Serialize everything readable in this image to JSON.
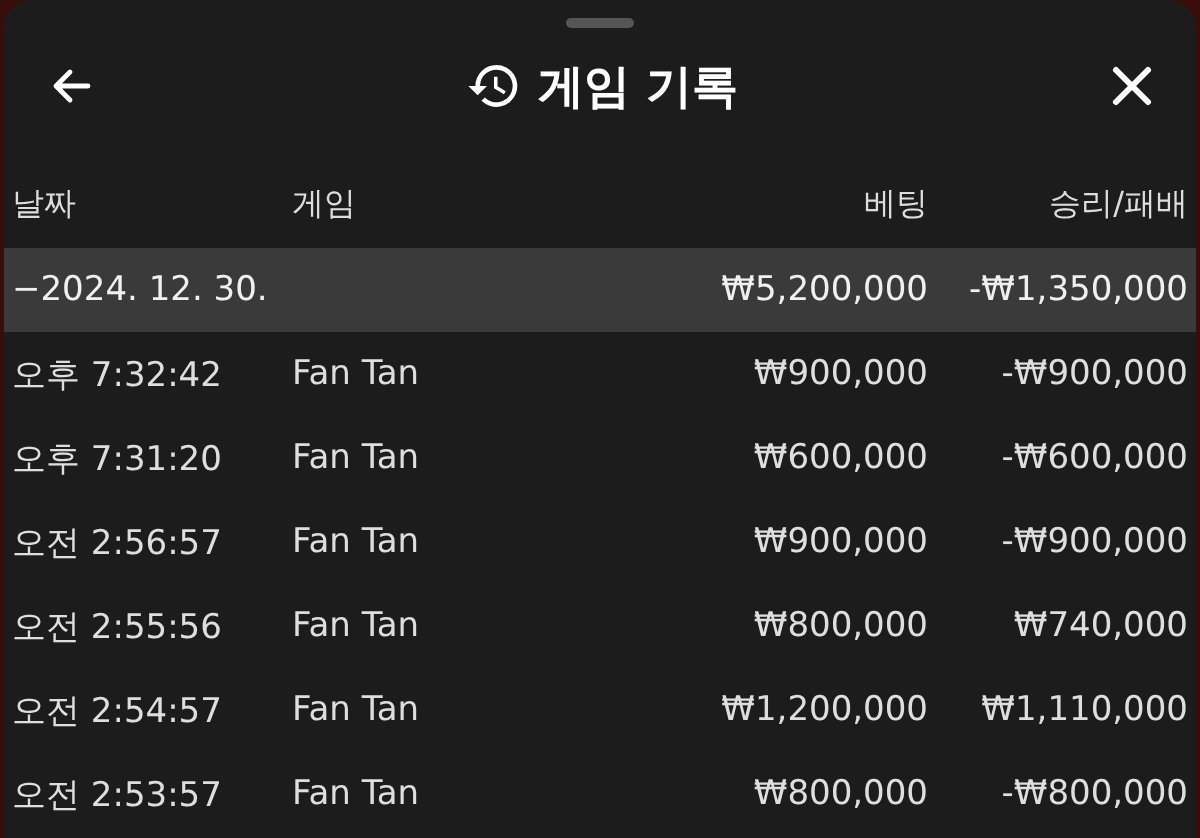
{
  "header": {
    "title": "게임 기록"
  },
  "table": {
    "columns": [
      "날짜",
      "게임",
      "베팅",
      "승리/패배"
    ],
    "group": {
      "date": "−2024. 12. 30.",
      "bet": "₩5,200,000",
      "result": "-₩1,350,000"
    },
    "rows": [
      {
        "time": "오후 7:32:42",
        "game": "Fan Tan",
        "bet": "₩900,000",
        "result": "-₩900,000"
      },
      {
        "time": "오후 7:31:20",
        "game": "Fan Tan",
        "bet": "₩600,000",
        "result": "-₩600,000"
      },
      {
        "time": "오전 2:56:57",
        "game": "Fan Tan",
        "bet": "₩900,000",
        "result": "-₩900,000"
      },
      {
        "time": "오전 2:55:56",
        "game": "Fan Tan",
        "bet": "₩800,000",
        "result": "₩740,000"
      },
      {
        "time": "오전 2:54:57",
        "game": "Fan Tan",
        "bet": "₩1,200,000",
        "result": "₩1,110,000"
      },
      {
        "time": "오전 2:53:57",
        "game": "Fan Tan",
        "bet": "₩800,000",
        "result": "-₩800,000"
      }
    ]
  }
}
